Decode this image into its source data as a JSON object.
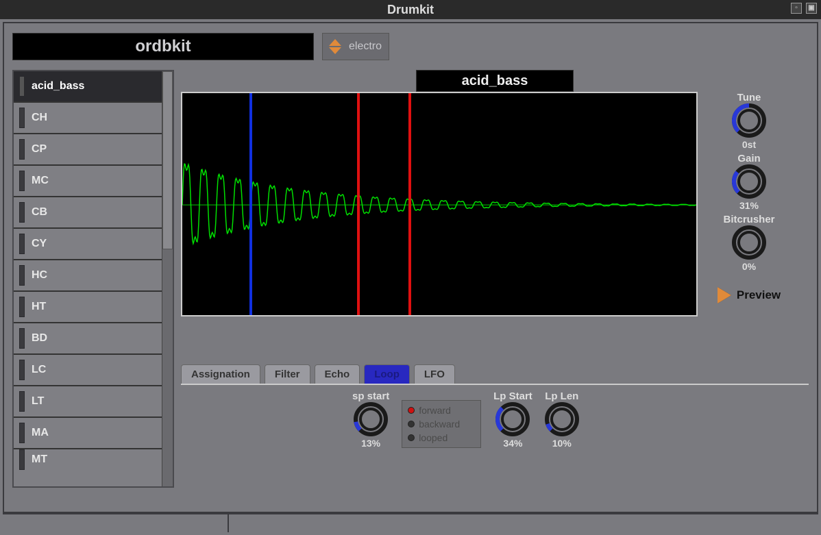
{
  "window": {
    "title": "Drumkit"
  },
  "kit": {
    "name": "ordbkit",
    "preset": "electro"
  },
  "sample": {
    "name": "acid_bass"
  },
  "sidebar": {
    "items": [
      {
        "label": "acid_bass",
        "selected": true
      },
      {
        "label": "CH"
      },
      {
        "label": "CP"
      },
      {
        "label": "MC"
      },
      {
        "label": "CB"
      },
      {
        "label": "CY"
      },
      {
        "label": "HC"
      },
      {
        "label": "HT"
      },
      {
        "label": "BD"
      },
      {
        "label": "LC"
      },
      {
        "label": "LT"
      },
      {
        "label": "MA"
      },
      {
        "label": "MT"
      }
    ]
  },
  "knobs": {
    "tune": {
      "label": "Tune",
      "value_text": "0st",
      "fill": 0.5
    },
    "gain": {
      "label": "Gain",
      "value_text": "31%",
      "fill": 0.31
    },
    "bitcrusher": {
      "label": "Bitcrusher",
      "value_text": "0%",
      "fill": 0.0
    }
  },
  "preview_label": "Preview",
  "tabs": [
    {
      "label": "Assignation",
      "active": false
    },
    {
      "label": "Filter",
      "active": false
    },
    {
      "label": "Echo",
      "active": false
    },
    {
      "label": "Loop",
      "active": true
    },
    {
      "label": "LFO",
      "active": false
    }
  ],
  "loop": {
    "sp_start": {
      "label": "sp start",
      "value_text": "13%",
      "fill": 0.13
    },
    "lp_start": {
      "label": "Lp Start",
      "value_text": "34%",
      "fill": 0.34
    },
    "lp_len": {
      "label": "Lp Len",
      "value_text": "10%",
      "fill": 0.1
    },
    "direction": {
      "options": [
        {
          "label": "forward",
          "selected": true
        },
        {
          "label": "backward",
          "selected": false
        },
        {
          "label": "looped",
          "selected": false
        }
      ]
    }
  },
  "markers": {
    "blue_pct": 13,
    "red1_pct": 34,
    "red2_pct": 44
  }
}
